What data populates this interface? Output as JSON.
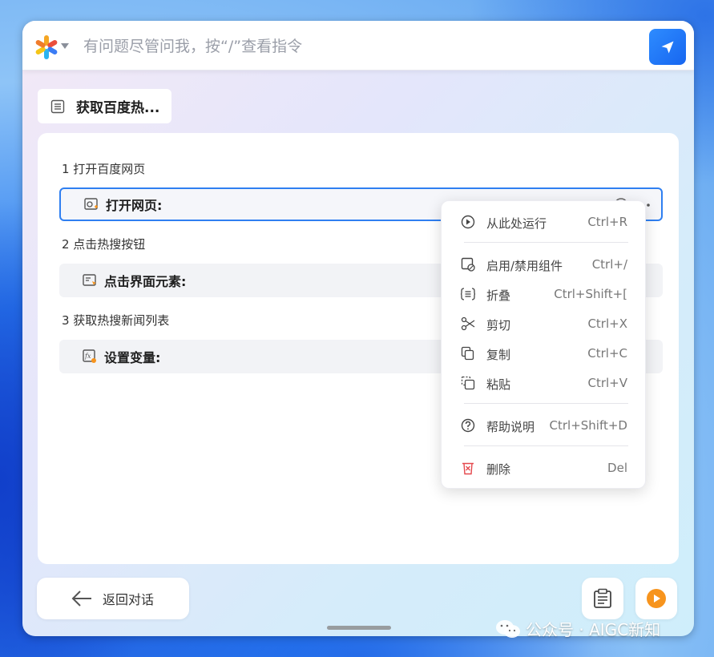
{
  "search": {
    "placeholder": "有问题尽管问我，按“/”查看指令"
  },
  "file_tab": {
    "label": "获取百度热..."
  },
  "steps": [
    {
      "title": "1 打开百度网页",
      "card_label": "打开网页:"
    },
    {
      "title": "2 点击热搜按钮",
      "card_label": "点击界面元素:"
    },
    {
      "title": "3 获取热搜新闻列表",
      "card_label": "设置变量:"
    }
  ],
  "context_menu": {
    "items": [
      {
        "label": "从此处运行",
        "shortcut": "Ctrl+R",
        "icon": "play-circle-icon"
      },
      {
        "label": "启用/禁用组件",
        "shortcut": "Ctrl+/",
        "icon": "toggle-component-icon"
      },
      {
        "label": "折叠",
        "shortcut": "Ctrl+Shift+[",
        "icon": "fold-icon"
      },
      {
        "label": "剪切",
        "shortcut": "Ctrl+X",
        "icon": "scissors-icon"
      },
      {
        "label": "复制",
        "shortcut": "Ctrl+C",
        "icon": "copy-icon"
      },
      {
        "label": "粘贴",
        "shortcut": "Ctrl+V",
        "icon": "paste-icon"
      },
      {
        "label": "帮助说明",
        "shortcut": "Ctrl+Shift+D",
        "icon": "help-icon"
      },
      {
        "label": "删除",
        "shortcut": "Del",
        "icon": "trash-icon"
      }
    ]
  },
  "bottom": {
    "back_label": "返回对话"
  },
  "watermark": {
    "text": "公众号 · AIGC新知"
  },
  "colors": {
    "accent": "#2f7ff1",
    "run": "#f7941d",
    "delete": "#e5484d"
  }
}
